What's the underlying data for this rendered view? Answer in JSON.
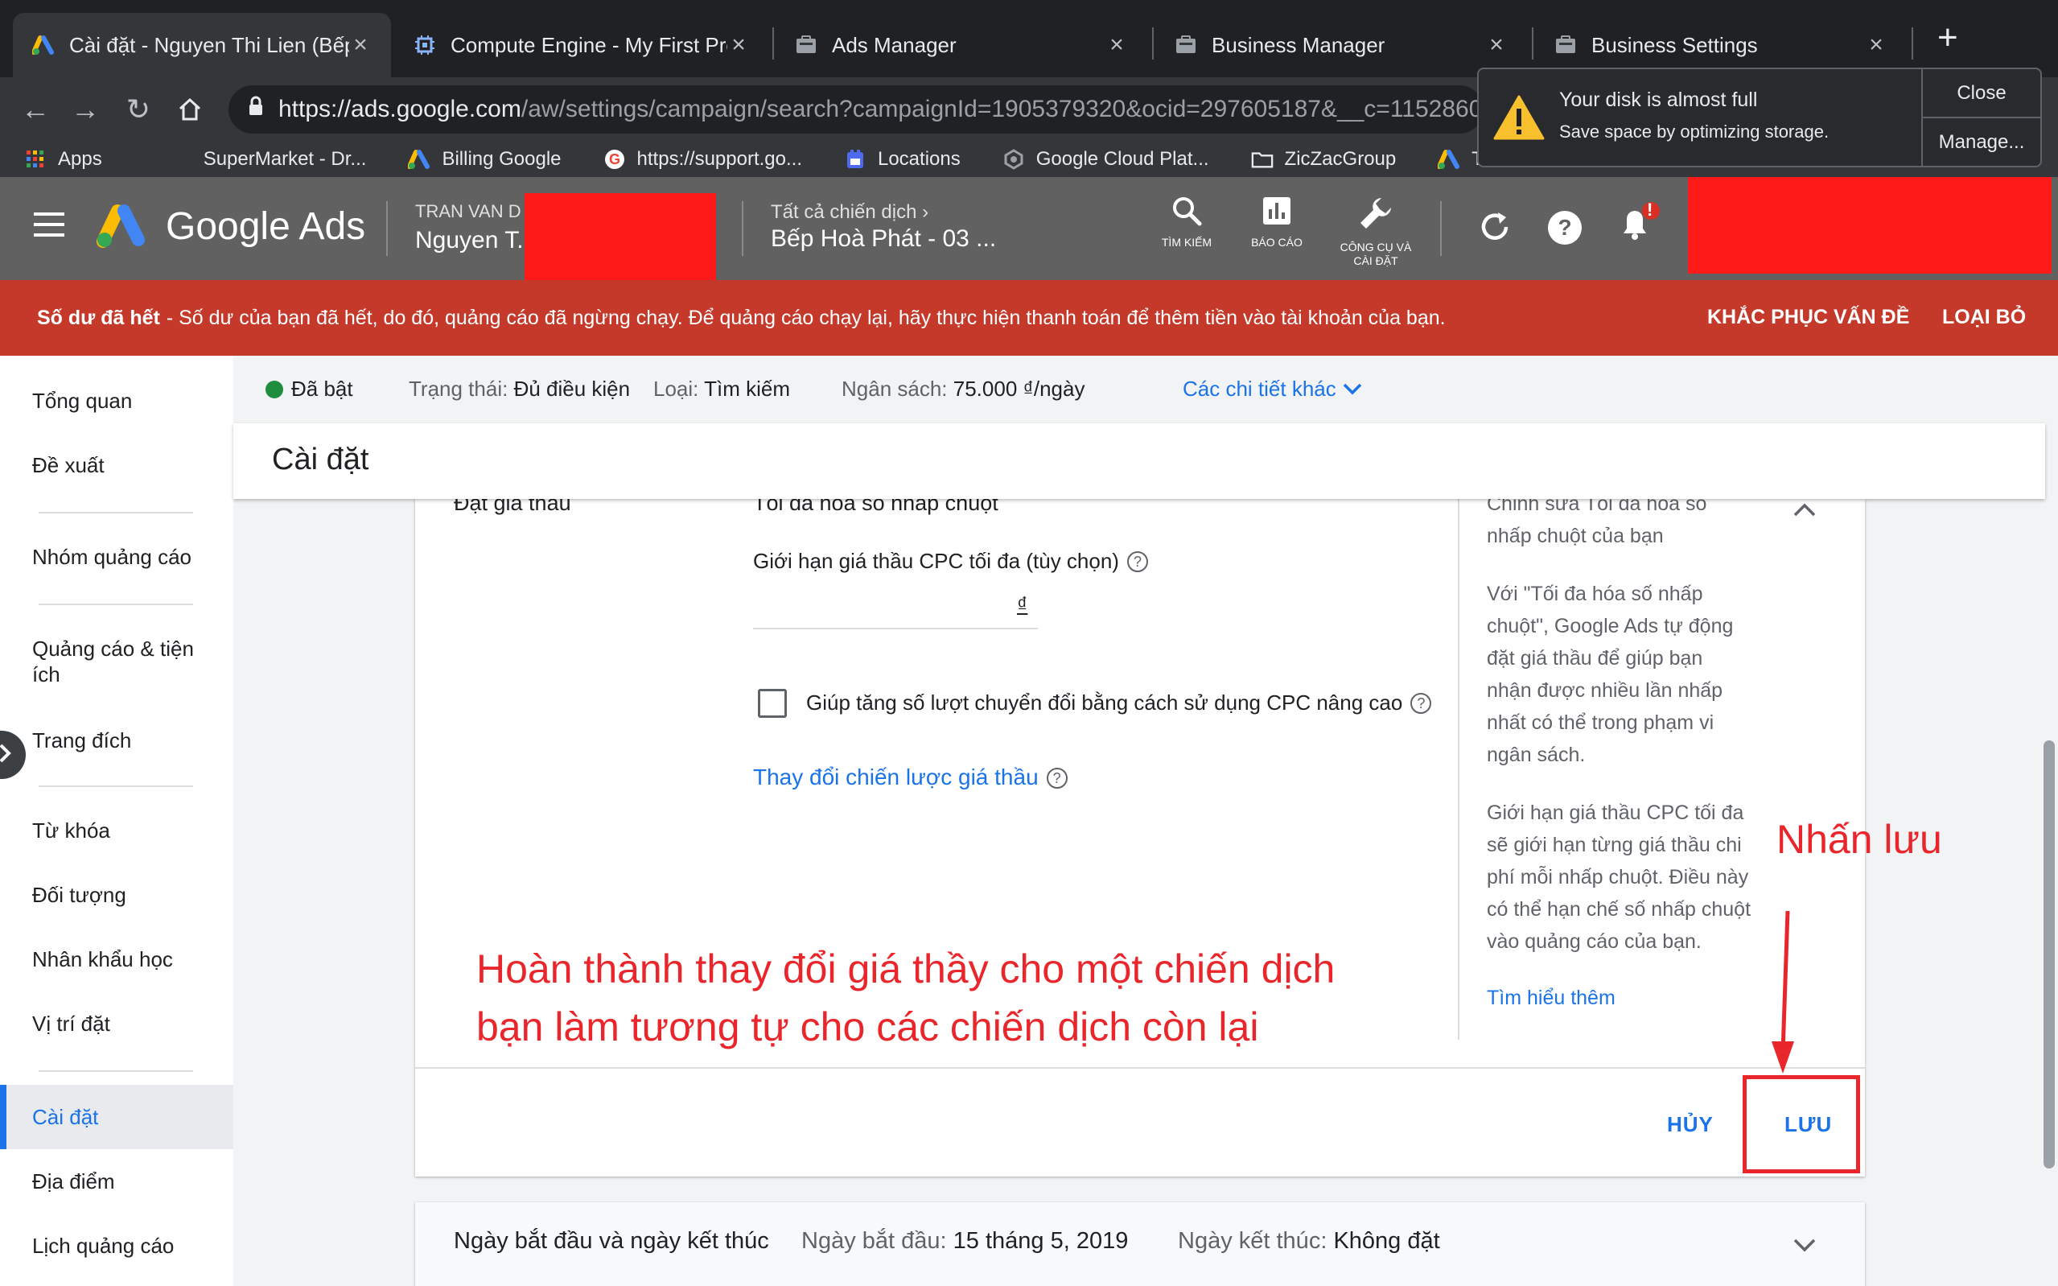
{
  "browser": {
    "tabs": [
      {
        "title": "Cài đặt - Nguyen Thi Lien (Bếp",
        "icon": "google-ads-icon"
      },
      {
        "title": "Compute Engine - My First Pro",
        "icon": "compute-engine-icon"
      },
      {
        "title": "Ads Manager",
        "icon": "ads-manager-icon"
      },
      {
        "title": "Business Manager",
        "icon": "business-manager-icon"
      },
      {
        "title": "Business Settings",
        "icon": "business-settings-icon"
      }
    ],
    "url_host": "https://ads.google.com",
    "url_path": "/aw/settings/campaign/search?campaignId=1905379320&ocid=297605187&__c=1152860",
    "bookmarks": [
      "Apps",
      "SuperMarket - Dr...",
      "Billing Google",
      "https://support.go...",
      "Locations",
      "Google Cloud Plat...",
      "ZicZacGroup",
      "Tổn"
    ],
    "disk_popup": {
      "title": "Your disk is almost full",
      "message": "Save space by optimizing storage.",
      "close": "Close",
      "manage": "Manage..."
    }
  },
  "ads_header": {
    "product": "Google Ads",
    "account_sub": "TRAN VAN D",
    "account_main": "Nguyen T.",
    "campaign_sub": "Tất cả chiến dịch",
    "campaign_main": "Bếp Hoà Phát - 03 ...",
    "tools": [
      {
        "label": "TÌM KIẾM",
        "icon": "search-icon"
      },
      {
        "label": "BÁO CÁO",
        "icon": "reports-icon"
      },
      {
        "label": "CÔNG CỤ VÀ CÀI ĐẶT",
        "icon": "wrench-icon"
      }
    ],
    "notification_badge": "!",
    "colors": {
      "header": "#616161",
      "redaction": "#ff1a1a"
    }
  },
  "banner": {
    "bold": "Số dư đã hết",
    "text": "- Số dư của bạn đã hết, do đó, quảng cáo đã ngừng chạy. Để quảng cáo chạy lại, hãy thực hiện thanh toán để thêm tiền vào tài khoản của bạn.",
    "fix": "KHẮC PHỤC VẤN ĐỀ",
    "dismiss": "LOẠI BỎ",
    "color": "#c5392b"
  },
  "sidebar": {
    "items": [
      "Tổng quan",
      "Đề xuất",
      "Nhóm quảng cáo",
      "Quảng cáo & tiện ích",
      "Trang đích",
      "Từ khóa",
      "Đối tượng",
      "Nhân khẩu học",
      "Vị trí đặt",
      "Cài đặt",
      "Địa điểm",
      "Lịch quảng cáo"
    ],
    "active": "Cài đặt"
  },
  "status": {
    "enabled": "Đã bật",
    "status_label": "Trạng thái:",
    "status_value": "Đủ điều kiện",
    "type_label": "Loại:",
    "type_value": "Tìm kiếm",
    "budget_label": "Ngân sách:",
    "budget_value": "75.000 ₫/ngày",
    "more": "Các chi tiết khác"
  },
  "page_title": "Cài đặt",
  "bidding": {
    "section_cut": "Đặt giá thầu",
    "strategy_cut": "Tối đa hoá số nhấp chuột",
    "cpc_label": "Giới hạn giá thầu CPC tối đa (tùy chọn)",
    "currency": "₫",
    "enhanced_cpc": "Giúp tăng số lượt chuyển đổi bằng cách sử dụng CPC nâng cao",
    "change_strategy": "Thay đổi chiến lược giá thầu",
    "help_cut": "Chỉnh sửa Tối đa hóa số",
    "help_lines": [
      "nhấp chuột của bạn",
      "Với \"Tối đa hóa số nhấp",
      "chuột\", Google Ads tự động",
      "đặt giá thầu để giúp bạn",
      "nhận được nhiều lần nhấp",
      "nhất có thể trong phạm vi",
      "ngân sách.",
      "Giới hạn giá thầu CPC tối đa",
      "sẽ giới hạn từng giá thầu chi",
      "phí mỗi nhấp chuột. Điều này",
      "có thể hạn chế số nhấp chuột",
      "vào quảng cáo của bạn."
    ],
    "learn_more": "Tìm hiểu thêm",
    "cancel": "HỦY",
    "save": "LƯU"
  },
  "dates": {
    "title": "Ngày bắt đầu và ngày kết thúc",
    "start_label": "Ngày bắt đầu:",
    "start_value": "15 tháng 5, 2019",
    "end_label": "Ngày kết thúc:",
    "end_value": "Không đặt"
  },
  "annotations": {
    "line1": "Hoàn thành thay đổi giá thầy cho một chiến dịch",
    "line2": "bạn làm tương tự cho các chiến dịch còn lại",
    "save_hint": "Nhấn lưu",
    "color": "#e8262b"
  }
}
